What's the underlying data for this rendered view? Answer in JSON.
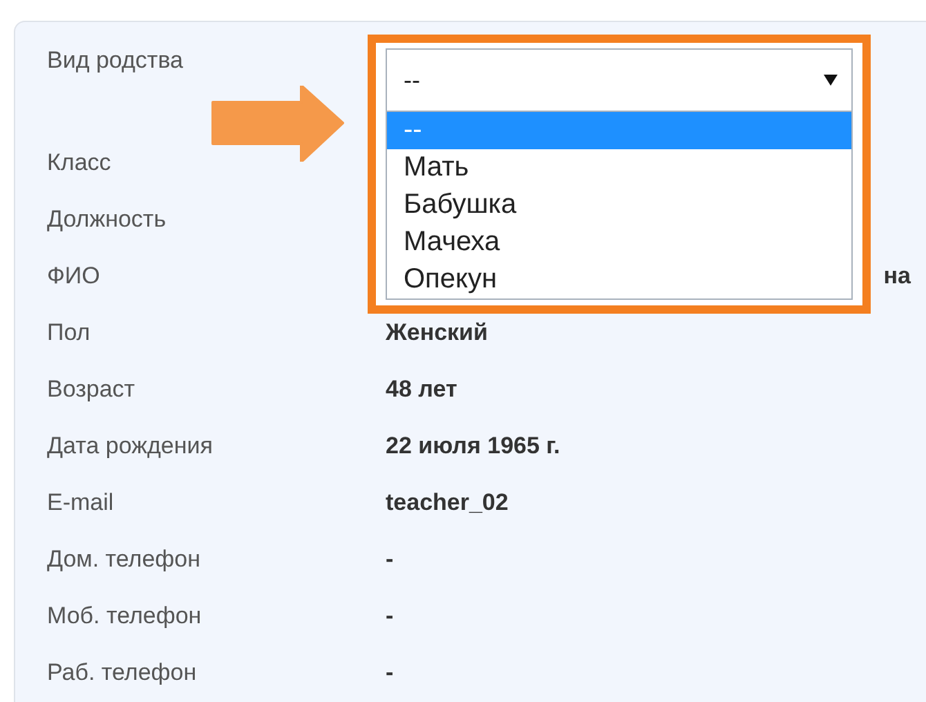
{
  "fields": [
    {
      "label": "Вид родства"
    },
    {
      "label": "Класс"
    },
    {
      "label": "Должность"
    },
    {
      "label": "ФИО",
      "value": "на",
      "covered_left": true
    },
    {
      "label": "Пол",
      "value": "Женский"
    },
    {
      "label": "Возраст",
      "value": "48 лет"
    },
    {
      "label": "Дата рождения",
      "value": "22 июля 1965 г."
    },
    {
      "label": "E-mail",
      "value": "teacher_02"
    },
    {
      "label": "Дом. телефон",
      "value": "-"
    },
    {
      "label": "Моб. телефон",
      "value": "-"
    },
    {
      "label": "Раб. телефон",
      "value": "-"
    }
  ],
  "dropdown": {
    "value": "--",
    "options": [
      {
        "label": "--",
        "selected": true
      },
      {
        "label": "Мать",
        "selected": false
      },
      {
        "label": "Бабушка",
        "selected": false
      },
      {
        "label": "Мачеха",
        "selected": false
      },
      {
        "label": "Опекун",
        "selected": false
      }
    ]
  }
}
